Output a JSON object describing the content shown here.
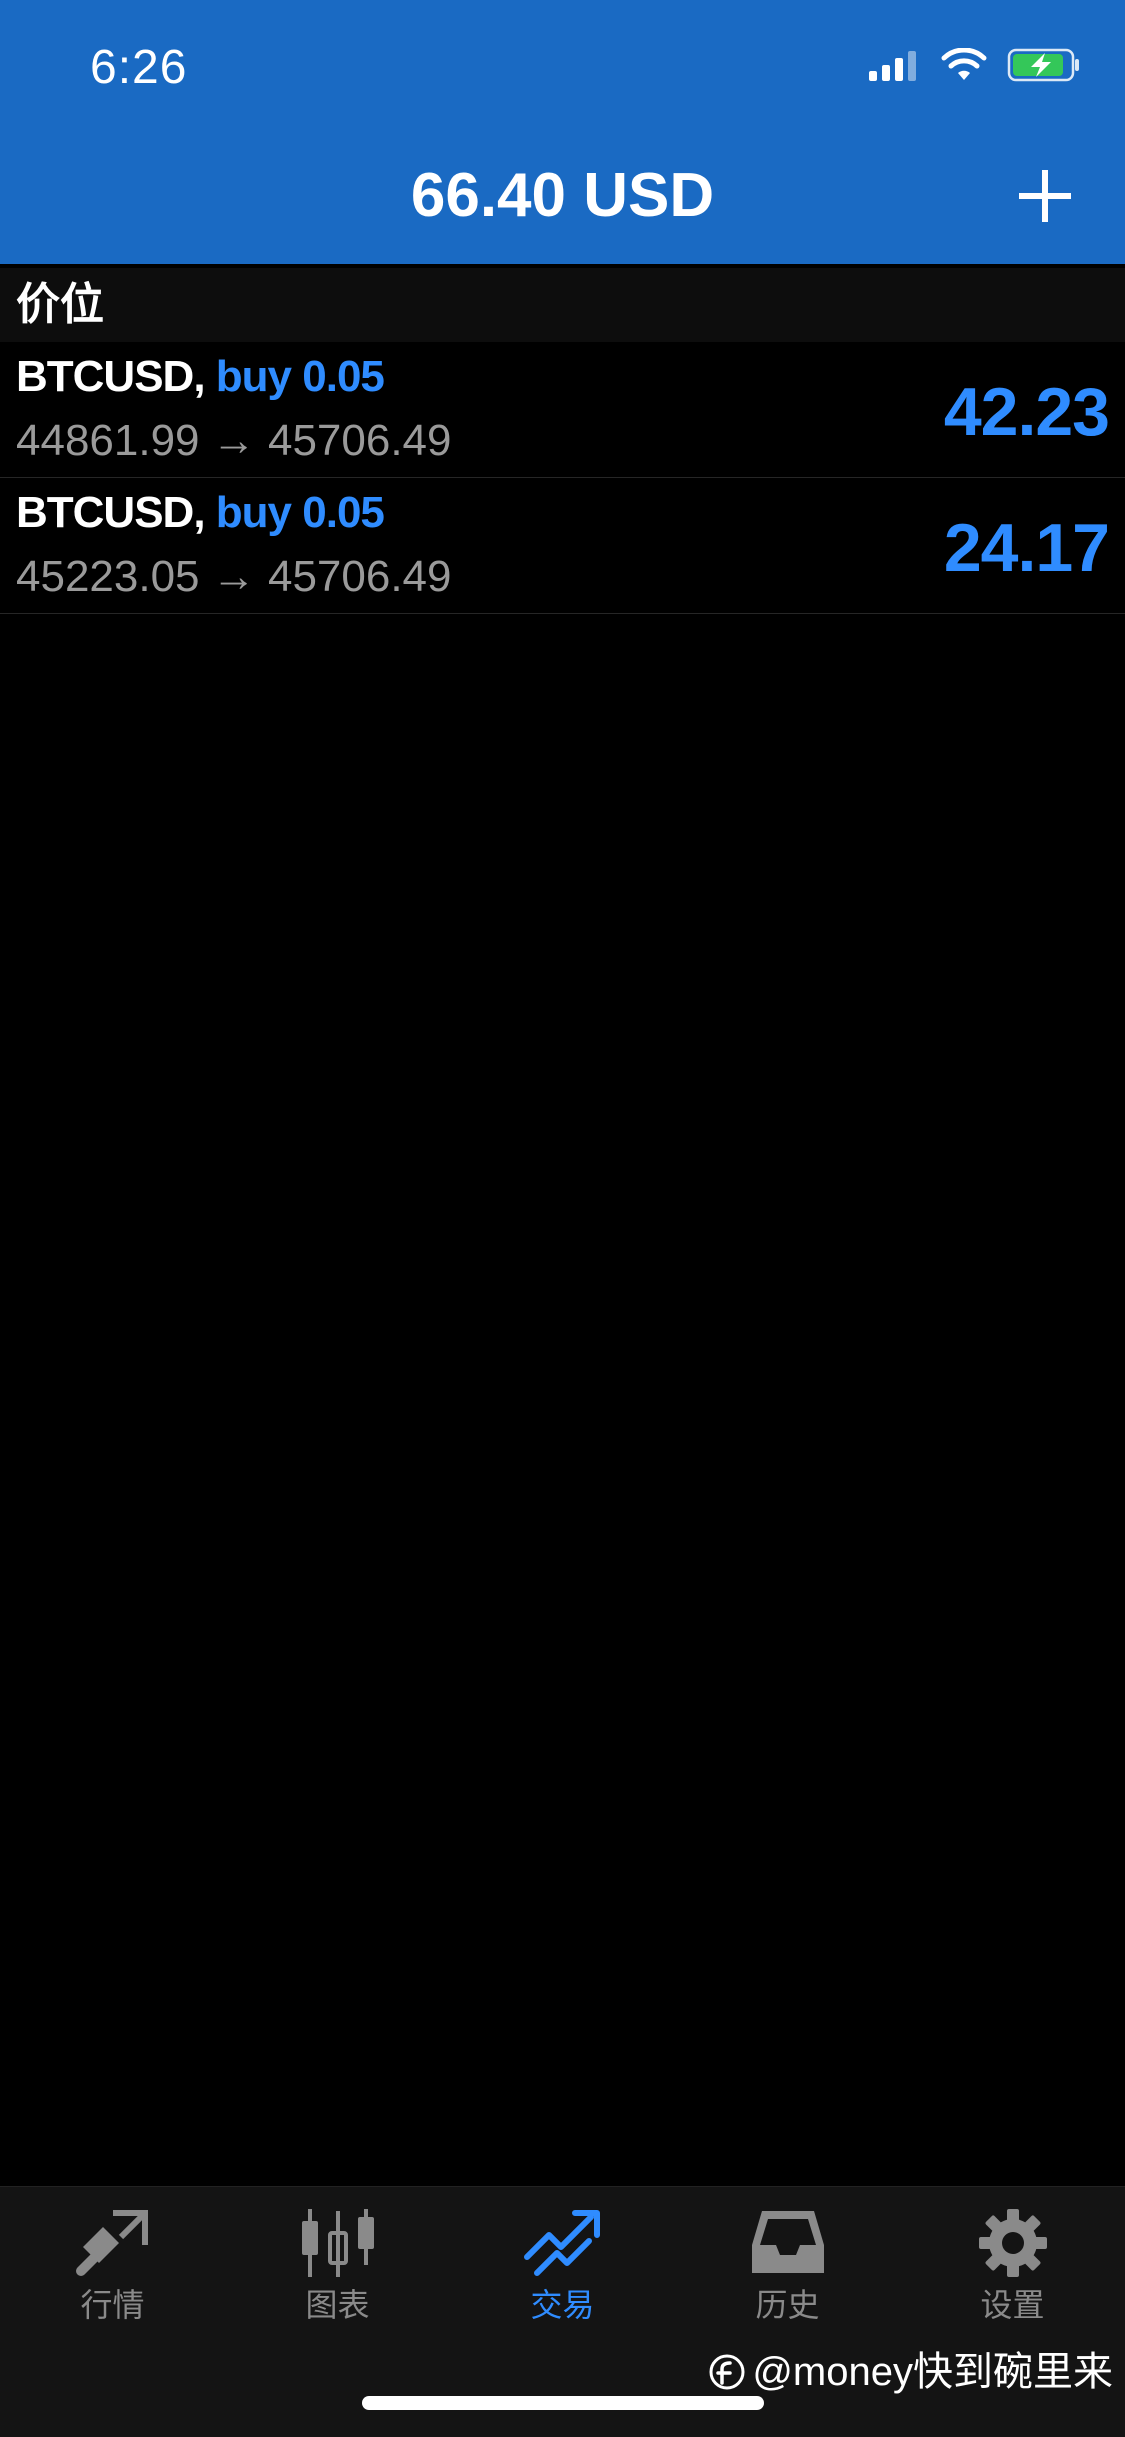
{
  "status_bar": {
    "time": "6:26",
    "icons": [
      "signal-icon",
      "wifi-icon",
      "battery-charging-icon"
    ]
  },
  "header": {
    "title": "66.40 USD",
    "add_icon": "plus-icon"
  },
  "section": {
    "title": "价位"
  },
  "positions": [
    {
      "symbol": "BTCUSD,",
      "side": "buy 0.05",
      "prices": "44861.99 → 45706.49",
      "profit": "42.23"
    },
    {
      "symbol": "BTCUSD,",
      "side": "buy 0.05",
      "prices": "45223.05 → 45706.49",
      "profit": "24.17"
    }
  ],
  "tabs": [
    {
      "label": "行情",
      "icon": "quotes-icon",
      "active": false
    },
    {
      "label": "图表",
      "icon": "candlestick-chart-icon",
      "active": false
    },
    {
      "label": "交易",
      "icon": "trade-icon",
      "active": true
    },
    {
      "label": "历史",
      "icon": "history-inbox-icon",
      "active": false
    },
    {
      "label": "设置",
      "icon": "gear-icon",
      "active": false
    }
  ],
  "watermark": "@money快到碗里来",
  "colors": {
    "header_bg": "#1a6ac3",
    "accent_blue": "#2f8cff",
    "background": "#000000",
    "muted_text": "#9a9a9a",
    "tab_inactive": "#8a8a8a"
  }
}
